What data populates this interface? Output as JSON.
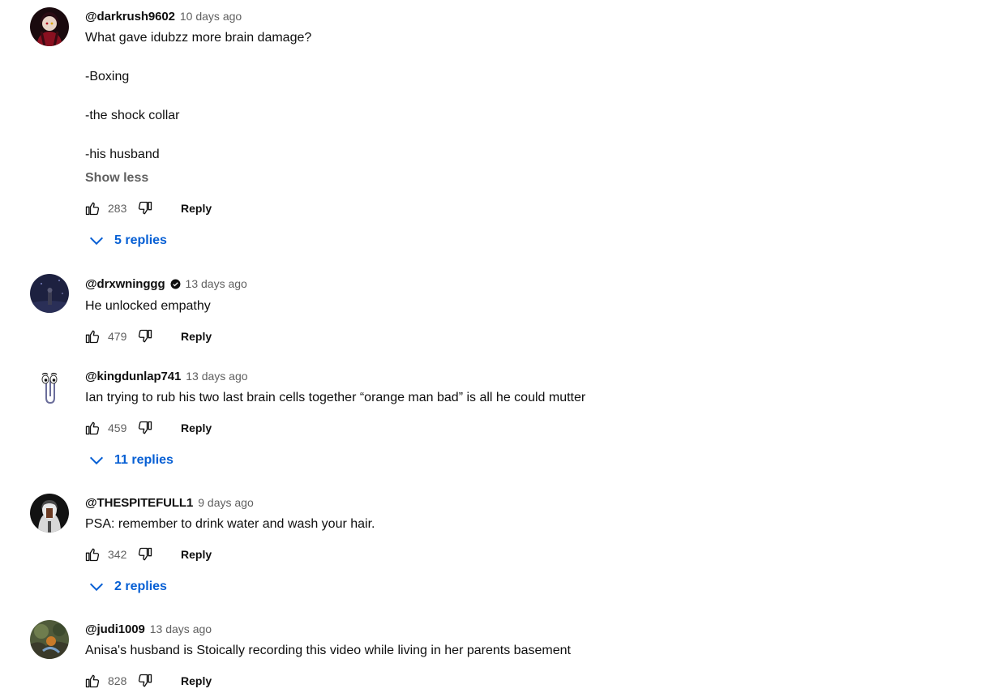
{
  "comments": [
    {
      "author": "@darkrush9602",
      "time": "10 days ago",
      "lines": [
        "What gave idubzz more brain damage?",
        "-Boxing",
        "-the shock collar",
        "-his husband"
      ],
      "show_less": "Show less",
      "likes": "283",
      "reply_label": "Reply",
      "replies_label": "5 replies"
    },
    {
      "author": "@drxwninggg",
      "verified": true,
      "time": "13 days ago",
      "lines": [
        "He unlocked empathy"
      ],
      "likes": "479",
      "reply_label": "Reply"
    },
    {
      "author": "@kingdunlap741",
      "time": "13 days ago",
      "lines": [
        "Ian trying to rub his two last brain cells together “orange man bad” is all he could mutter"
      ],
      "likes": "459",
      "reply_label": "Reply",
      "replies_label": "11 replies"
    },
    {
      "author": "@THESPITEFULL1",
      "time": "9 days ago",
      "lines": [
        "PSA: remember to drink water and wash your hair."
      ],
      "likes": "342",
      "reply_label": "Reply",
      "replies_label": "2 replies"
    },
    {
      "author": "@judi1009",
      "time": "13 days ago",
      "lines": [
        "Anisa's husband is Stoically recording this video while living in her parents basement"
      ],
      "likes": "828",
      "reply_label": "Reply"
    }
  ],
  "icons": {
    "like": "thumb-up-icon",
    "dislike": "thumb-down-icon",
    "expand": "chevron-down-icon",
    "verified": "verified-badge-icon"
  },
  "colors": {
    "replies_link": "#065fd4",
    "secondary_text": "#606060",
    "primary_text": "#0f0f0f"
  }
}
